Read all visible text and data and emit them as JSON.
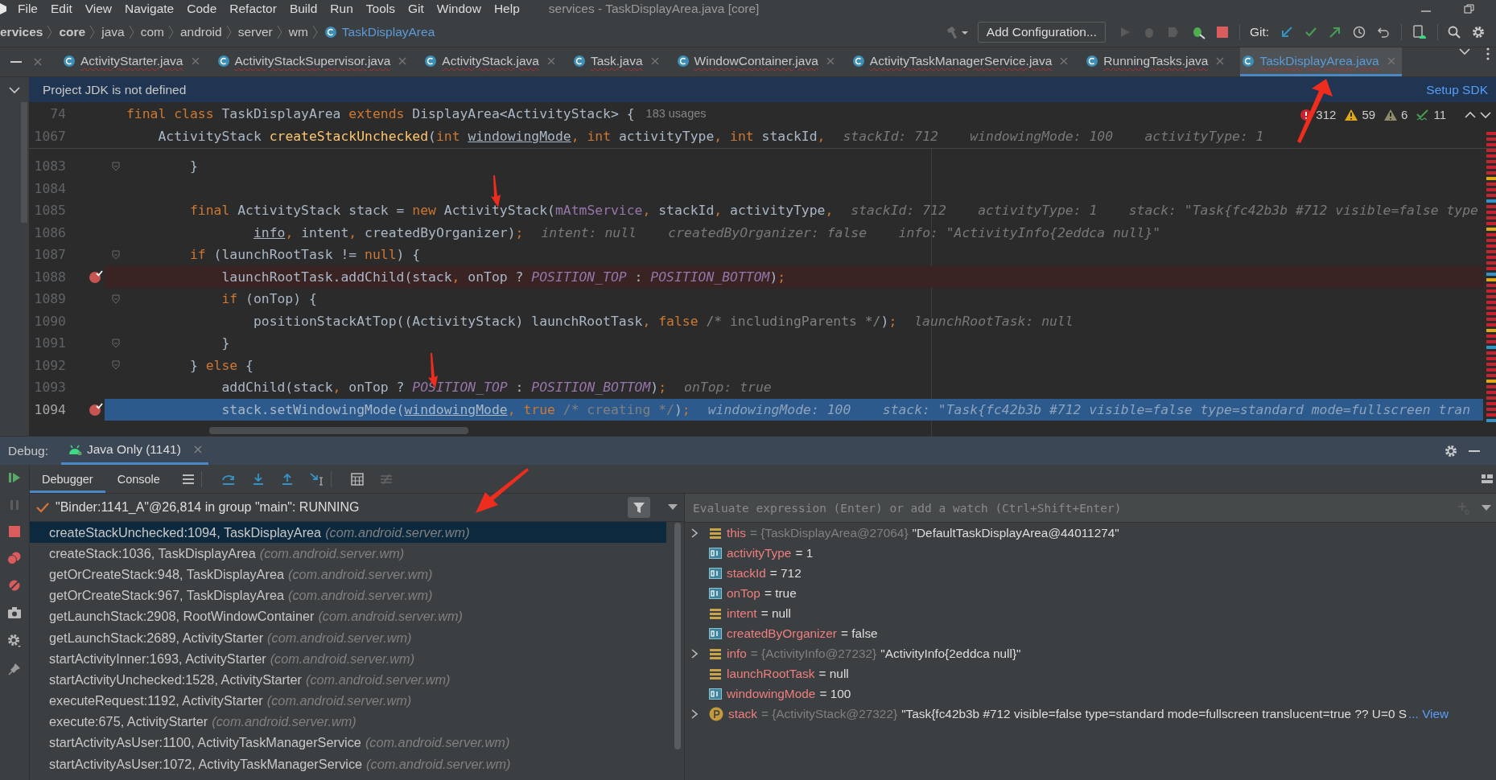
{
  "menu": {
    "items": [
      "File",
      "Edit",
      "View",
      "Navigate",
      "Code",
      "Refactor",
      "Build",
      "Run",
      "Tools",
      "Git",
      "Window",
      "Help"
    ],
    "title": "services - TaskDisplayArea.java [core]"
  },
  "breadcrumbs": [
    {
      "label": "ervices",
      "kind": "module"
    },
    {
      "label": "core",
      "kind": "module"
    },
    {
      "label": "java",
      "kind": "dir"
    },
    {
      "label": "com",
      "kind": "dir"
    },
    {
      "label": "android",
      "kind": "dir"
    },
    {
      "label": "server",
      "kind": "dir"
    },
    {
      "label": "wm",
      "kind": "dir"
    },
    {
      "label": "TaskDisplayArea",
      "kind": "class"
    }
  ],
  "toolbar": {
    "run_config": "Add Configuration...",
    "git_label": "Git:"
  },
  "tabs": [
    {
      "label": "ActivityStarter.java",
      "selected": false
    },
    {
      "label": "ActivityStackSupervisor.java",
      "selected": false
    },
    {
      "label": "ActivityStack.java",
      "selected": false
    },
    {
      "label": "Task.java",
      "selected": false
    },
    {
      "label": "WindowContainer.java",
      "selected": false
    },
    {
      "label": "ActivityTaskManagerService.java",
      "selected": false
    },
    {
      "label": "RunningTasks.java",
      "selected": false
    },
    {
      "label": "TaskDisplayArea.java",
      "selected": true
    }
  ],
  "banner": {
    "message": "Project JDK is not defined",
    "action": "Setup SDK"
  },
  "inspections": {
    "errors": "312",
    "warnings": "59",
    "weak_warnings": "6",
    "typos": "11"
  },
  "sticky_lines": [
    {
      "number": "74",
      "tokens": [
        {
          "kind": "keyword",
          "text": "final class "
        },
        {
          "kind": "plain",
          "text": "TaskDisplayArea "
        },
        {
          "kind": "keyword",
          "text": "extends "
        },
        {
          "kind": "plain",
          "text": "DisplayArea<ActivityStack> {"
        }
      ],
      "usages": "183 usages"
    },
    {
      "number": "1067",
      "tokens": [
        {
          "kind": "plain",
          "text": "    ActivityStack "
        },
        {
          "kind": "method",
          "text": "createStackUnchecked"
        },
        {
          "kind": "plain",
          "text": "("
        },
        {
          "kind": "keyword",
          "text": "int "
        },
        {
          "kind": "param",
          "text": "windowingMode"
        },
        {
          "kind": "keyword",
          "text": ", int "
        },
        {
          "kind": "plain",
          "text": "activityType"
        },
        {
          "kind": "keyword",
          "text": ", int "
        },
        {
          "kind": "plain",
          "text": "stackId"
        },
        {
          "kind": "keyword",
          "text": ","
        }
      ],
      "hint": "stackId: 712    windowingMode: 100    activityType: 1"
    }
  ],
  "lines": [
    {
      "number": "1083",
      "fold": true,
      "breakpoint": false,
      "current": false,
      "tokens": [
        {
          "kind": "plain",
          "text": "        }"
        }
      ]
    },
    {
      "number": "1084",
      "fold": false,
      "breakpoint": false,
      "current": false
    },
    {
      "number": "1085",
      "fold": false,
      "breakpoint": false,
      "current": false,
      "tokens": [
        {
          "kind": "keyword",
          "text": "        final "
        },
        {
          "kind": "plain",
          "text": "ActivityStack stack = "
        },
        {
          "kind": "keyword",
          "text": "new "
        },
        {
          "kind": "plain",
          "text": "ActivityStack("
        },
        {
          "kind": "field",
          "text": "mAtmService"
        },
        {
          "kind": "keyword",
          "text": ", "
        },
        {
          "kind": "plain",
          "text": "stackId"
        },
        {
          "kind": "keyword",
          "text": ", "
        },
        {
          "kind": "plain",
          "text": "activityType"
        },
        {
          "kind": "keyword",
          "text": ","
        }
      ],
      "hint": "stackId: 712    activityType: 1    stack: \"Task{fc42b3b #712 visible=false type"
    },
    {
      "number": "1086",
      "fold": false,
      "breakpoint": false,
      "current": false,
      "tokens": [
        {
          "kind": "param",
          "text": "                info"
        },
        {
          "kind": "keyword",
          "text": ", "
        },
        {
          "kind": "plain",
          "text": "intent"
        },
        {
          "kind": "keyword",
          "text": ", "
        },
        {
          "kind": "plain",
          "text": "createdByOrganizer)"
        },
        {
          "kind": "keyword",
          "text": ";"
        }
      ],
      "hint": "intent: null    createdByOrganizer: false    info: \"ActivityInfo{2eddca null}\""
    },
    {
      "number": "1087",
      "fold": true,
      "breakpoint": false,
      "current": false,
      "tokens": [
        {
          "kind": "keyword",
          "text": "        if "
        },
        {
          "kind": "plain",
          "text": "(launchRootTask != "
        },
        {
          "kind": "keyword",
          "text": "null"
        },
        {
          "kind": "plain",
          "text": ") {"
        }
      ]
    },
    {
      "number": "1088",
      "fold": false,
      "breakpoint": true,
      "current": false,
      "tokens": [
        {
          "kind": "plain",
          "text": "            launchRootTask.addChild(stack"
        },
        {
          "kind": "keyword",
          "text": ", "
        },
        {
          "kind": "plain",
          "text": "onTop ? "
        },
        {
          "kind": "constant",
          "text": "POSITION_TOP"
        },
        {
          "kind": "plain",
          "text": " : "
        },
        {
          "kind": "constant",
          "text": "POSITION_BOTTOM"
        },
        {
          "kind": "plain",
          "text": ")"
        },
        {
          "kind": "keyword",
          "text": ";"
        }
      ]
    },
    {
      "number": "1089",
      "fold": true,
      "breakpoint": false,
      "current": false,
      "tokens": [
        {
          "kind": "keyword",
          "text": "            if "
        },
        {
          "kind": "plain",
          "text": "(onTop) {"
        }
      ]
    },
    {
      "number": "1090",
      "fold": false,
      "breakpoint": false,
      "current": false,
      "tokens": [
        {
          "kind": "plain",
          "text": "                positionStackAtTop((ActivityStack) launchRootTask"
        },
        {
          "kind": "keyword",
          "text": ", false "
        },
        {
          "kind": "comment",
          "text": "/* includingParents */"
        },
        {
          "kind": "plain",
          "text": ")"
        },
        {
          "kind": "keyword",
          "text": ";"
        }
      ],
      "hint": "launchRootTask: null"
    },
    {
      "number": "1091",
      "fold": true,
      "breakpoint": false,
      "current": false,
      "tokens": [
        {
          "kind": "plain",
          "text": "            }"
        }
      ]
    },
    {
      "number": "1092",
      "fold": true,
      "breakpoint": false,
      "current": false,
      "tokens": [
        {
          "kind": "plain",
          "text": "        } "
        },
        {
          "kind": "keyword",
          "text": "else "
        },
        {
          "kind": "plain",
          "text": "{"
        }
      ]
    },
    {
      "number": "1093",
      "fold": false,
      "breakpoint": false,
      "current": false,
      "tokens": [
        {
          "kind": "plain",
          "text": "            addChild(stack"
        },
        {
          "kind": "keyword",
          "text": ", "
        },
        {
          "kind": "plain",
          "text": "onTop ? "
        },
        {
          "kind": "constant",
          "text": "POSITION_TOP"
        },
        {
          "kind": "plain",
          "text": " : "
        },
        {
          "kind": "constant",
          "text": "POSITION_BOTTOM"
        },
        {
          "kind": "plain",
          "text": ")"
        },
        {
          "kind": "keyword",
          "text": ";"
        }
      ],
      "hint": "onTop: true"
    },
    {
      "number": "1094",
      "fold": false,
      "breakpoint": true,
      "current": true,
      "tokens": [
        {
          "kind": "plain",
          "text": "            stack.setWindowingMode("
        },
        {
          "kind": "param",
          "text": "windowingMode"
        },
        {
          "kind": "keyword",
          "text": ", true "
        },
        {
          "kind": "comment",
          "text": "/* creating */"
        },
        {
          "kind": "plain",
          "text": ")"
        },
        {
          "kind": "keyword",
          "text": ";"
        }
      ],
      "hint": "windowingMode: 100    stack: \"Task{fc42b3b #712 visible=false type=standard mode=fullscreen tran"
    }
  ],
  "debug": {
    "label": "Debug:",
    "session": "Java Only (1141)",
    "tabs": [
      {
        "label": "Debugger",
        "selected": true
      },
      {
        "label": "Console",
        "selected": false
      }
    ],
    "thread": "\"Binder:1141_A\"@26,814 in group \"main\": RUNNING",
    "frames": [
      {
        "method": "createStackUnchecked:1094, TaskDisplayArea",
        "package": "(com.android.server.wm)",
        "selected": true
      },
      {
        "method": "createStack:1036, TaskDisplayArea",
        "package": "(com.android.server.wm)",
        "selected": false
      },
      {
        "method": "getOrCreateStack:948, TaskDisplayArea",
        "package": "(com.android.server.wm)",
        "selected": false
      },
      {
        "method": "getOrCreateStack:967, TaskDisplayArea",
        "package": "(com.android.server.wm)",
        "selected": false
      },
      {
        "method": "getLaunchStack:2908, RootWindowContainer",
        "package": "(com.android.server.wm)",
        "selected": false
      },
      {
        "method": "getLaunchStack:2689, ActivityStarter",
        "package": "(com.android.server.wm)",
        "selected": false
      },
      {
        "method": "startActivityInner:1693, ActivityStarter",
        "package": "(com.android.server.wm)",
        "selected": false
      },
      {
        "method": "startActivityUnchecked:1528, ActivityStarter",
        "package": "(com.android.server.wm)",
        "selected": false
      },
      {
        "method": "executeRequest:1192, ActivityStarter",
        "package": "(com.android.server.wm)",
        "selected": false
      },
      {
        "method": "execute:675, ActivityStarter",
        "package": "(com.android.server.wm)",
        "selected": false
      },
      {
        "method": "startActivityAsUser:1100, ActivityTaskManagerService",
        "package": "(com.android.server.wm)",
        "selected": false
      },
      {
        "method": "startActivityAsUser:1072, ActivityTaskManagerService",
        "package": "(com.android.server.wm)",
        "selected": false
      }
    ],
    "evaluate": {
      "placeholder": "Evaluate expression (Enter) or add a watch (Ctrl+Shift+Enter)"
    },
    "variables": [
      {
        "name": "this",
        "type": "= {TaskDisplayArea@27064}",
        "value": "\"DefaultTaskDisplayArea@44011274\"",
        "kind": "object",
        "expandable": true
      },
      {
        "name": "activityType",
        "value": "= 1",
        "kind": "primitive",
        "expandable": false
      },
      {
        "name": "stackId",
        "value": "= 712",
        "kind": "primitive",
        "expandable": false
      },
      {
        "name": "onTop",
        "value": "= true",
        "kind": "primitive",
        "expandable": false
      },
      {
        "name": "intent",
        "value": "= null",
        "kind": "object",
        "expandable": false
      },
      {
        "name": "createdByOrganizer",
        "value": "= false",
        "kind": "primitive",
        "expandable": false
      },
      {
        "name": "info",
        "type": "= {ActivityInfo@27232}",
        "value": "\"ActivityInfo{2eddca null}\"",
        "kind": "object",
        "expandable": true
      },
      {
        "name": "launchRootTask",
        "value": "= null",
        "kind": "object",
        "expandable": false
      },
      {
        "name": "windowingMode",
        "value": "= 100",
        "kind": "primitive",
        "expandable": false
      },
      {
        "name": "stack",
        "type": "= {ActivityStack@27322}",
        "value": "\"Task{fc42b3b #712 visible=false type=standard mode=fullscreen translucent=true ?? U=0 S",
        "link": "... View",
        "kind": "param",
        "expandable": true
      }
    ]
  }
}
